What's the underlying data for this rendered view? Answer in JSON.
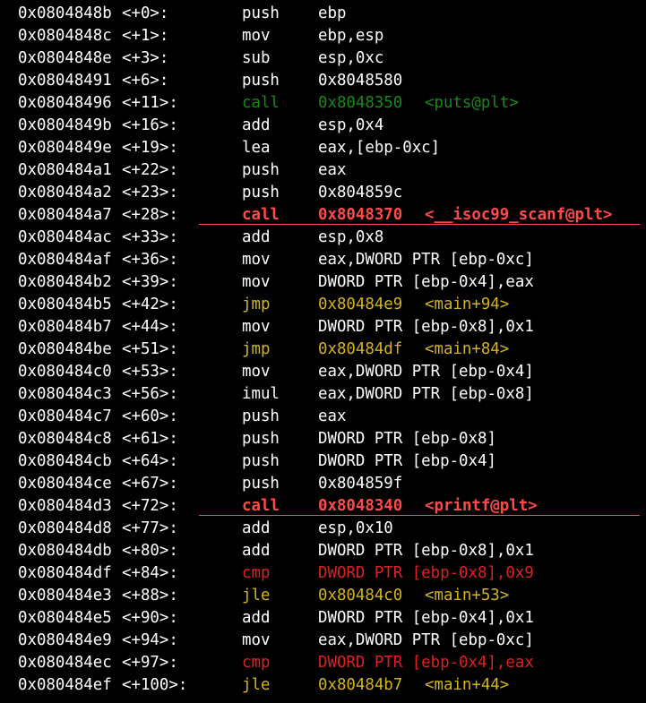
{
  "colors": {
    "background": "#000000",
    "default": "#ffffff",
    "call_plain": "#188a18",
    "jump": "#d6b419",
    "compare": "#e02020",
    "call_highlight": "#ff4a4a"
  },
  "instructions": [
    {
      "addr": "0x0804848b",
      "offset": "<+0>:",
      "mnemonic": "push",
      "operand": "ebp",
      "symbol": "",
      "style": "white",
      "highlight": false
    },
    {
      "addr": "0x0804848c",
      "offset": "<+1>:",
      "mnemonic": "mov",
      "operand": "ebp,esp",
      "symbol": "",
      "style": "white",
      "highlight": false
    },
    {
      "addr": "0x0804848e",
      "offset": "<+3>:",
      "mnemonic": "sub",
      "operand": "esp,0xc",
      "symbol": "",
      "style": "white",
      "highlight": false
    },
    {
      "addr": "0x08048491",
      "offset": "<+6>:",
      "mnemonic": "push",
      "operand": "0x8048580",
      "symbol": "",
      "style": "white",
      "highlight": false
    },
    {
      "addr": "0x08048496",
      "offset": "<+11>:",
      "mnemonic": "call",
      "operand": "0x8048350",
      "symbol": "<puts@plt>",
      "style": "green",
      "highlight": false
    },
    {
      "addr": "0x0804849b",
      "offset": "<+16>:",
      "mnemonic": "add",
      "operand": "esp,0x4",
      "symbol": "",
      "style": "white",
      "highlight": false
    },
    {
      "addr": "0x0804849e",
      "offset": "<+19>:",
      "mnemonic": "lea",
      "operand": "eax,[ebp-0xc]",
      "symbol": "",
      "style": "white",
      "highlight": false
    },
    {
      "addr": "0x080484a1",
      "offset": "<+22>:",
      "mnemonic": "push",
      "operand": "eax",
      "symbol": "",
      "style": "white",
      "highlight": false
    },
    {
      "addr": "0x080484a2",
      "offset": "<+23>:",
      "mnemonic": "push",
      "operand": "0x804859c",
      "symbol": "",
      "style": "white",
      "highlight": false
    },
    {
      "addr": "0x080484a7",
      "offset": "<+28>:",
      "mnemonic": "call",
      "operand": "0x8048370",
      "symbol": "<__isoc99_scanf@plt>",
      "style": "bred",
      "highlight": true
    },
    {
      "addr": "0x080484ac",
      "offset": "<+33>:",
      "mnemonic": "add",
      "operand": "esp,0x8",
      "symbol": "",
      "style": "white",
      "highlight": false
    },
    {
      "addr": "0x080484af",
      "offset": "<+36>:",
      "mnemonic": "mov",
      "operand": "eax,DWORD PTR [ebp-0xc]",
      "symbol": "",
      "style": "white",
      "highlight": false
    },
    {
      "addr": "0x080484b2",
      "offset": "<+39>:",
      "mnemonic": "mov",
      "operand": "DWORD PTR [ebp-0x4],eax",
      "symbol": "",
      "style": "white",
      "highlight": false
    },
    {
      "addr": "0x080484b5",
      "offset": "<+42>:",
      "mnemonic": "jmp",
      "operand": "0x80484e9",
      "symbol": "<main+94>",
      "style": "yellow",
      "highlight": false
    },
    {
      "addr": "0x080484b7",
      "offset": "<+44>:",
      "mnemonic": "mov",
      "operand": "DWORD PTR [ebp-0x8],0x1",
      "symbol": "",
      "style": "white",
      "highlight": false
    },
    {
      "addr": "0x080484be",
      "offset": "<+51>:",
      "mnemonic": "jmp",
      "operand": "0x80484df",
      "symbol": "<main+84>",
      "style": "yellow",
      "highlight": false
    },
    {
      "addr": "0x080484c0",
      "offset": "<+53>:",
      "mnemonic": "mov",
      "operand": "eax,DWORD PTR [ebp-0x4]",
      "symbol": "",
      "style": "white",
      "highlight": false
    },
    {
      "addr": "0x080484c3",
      "offset": "<+56>:",
      "mnemonic": "imul",
      "operand": "eax,DWORD PTR [ebp-0x8]",
      "symbol": "",
      "style": "white",
      "highlight": false
    },
    {
      "addr": "0x080484c7",
      "offset": "<+60>:",
      "mnemonic": "push",
      "operand": "eax",
      "symbol": "",
      "style": "white",
      "highlight": false
    },
    {
      "addr": "0x080484c8",
      "offset": "<+61>:",
      "mnemonic": "push",
      "operand": "DWORD PTR [ebp-0x8]",
      "symbol": "",
      "style": "white",
      "highlight": false
    },
    {
      "addr": "0x080484cb",
      "offset": "<+64>:",
      "mnemonic": "push",
      "operand": "DWORD PTR [ebp-0x4]",
      "symbol": "",
      "style": "white",
      "highlight": false
    },
    {
      "addr": "0x080484ce",
      "offset": "<+67>:",
      "mnemonic": "push",
      "operand": "0x804859f",
      "symbol": "",
      "style": "white",
      "highlight": false
    },
    {
      "addr": "0x080484d3",
      "offset": "<+72>:",
      "mnemonic": "call",
      "operand": "0x8048340",
      "symbol": "<printf@plt>",
      "style": "bred",
      "highlight": true
    },
    {
      "addr": "0x080484d8",
      "offset": "<+77>:",
      "mnemonic": "add",
      "operand": "esp,0x10",
      "symbol": "",
      "style": "white",
      "highlight": false
    },
    {
      "addr": "0x080484db",
      "offset": "<+80>:",
      "mnemonic": "add",
      "operand": "DWORD PTR [ebp-0x8],0x1",
      "symbol": "",
      "style": "white",
      "highlight": false
    },
    {
      "addr": "0x080484df",
      "offset": "<+84>:",
      "mnemonic": "cmp",
      "operand": "DWORD PTR [ebp-0x8],0x9",
      "symbol": "",
      "style": "red",
      "highlight": false
    },
    {
      "addr": "0x080484e3",
      "offset": "<+88>:",
      "mnemonic": "jle",
      "operand": "0x80484c0",
      "symbol": "<main+53>",
      "style": "yellow",
      "highlight": false
    },
    {
      "addr": "0x080484e5",
      "offset": "<+90>:",
      "mnemonic": "add",
      "operand": "DWORD PTR [ebp-0x4],0x1",
      "symbol": "",
      "style": "white",
      "highlight": false
    },
    {
      "addr": "0x080484e9",
      "offset": "<+94>:",
      "mnemonic": "mov",
      "operand": "eax,DWORD PTR [ebp-0xc]",
      "symbol": "",
      "style": "white",
      "highlight": false
    },
    {
      "addr": "0x080484ec",
      "offset": "<+97>:",
      "mnemonic": "cmp",
      "operand": "DWORD PTR [ebp-0x4],eax",
      "symbol": "",
      "style": "red",
      "highlight": false
    },
    {
      "addr": "0x080484ef",
      "offset": "<+100>:",
      "mnemonic": "jle",
      "operand": "0x80484b7",
      "symbol": "<main+44>",
      "style": "yellow",
      "highlight": false
    }
  ]
}
